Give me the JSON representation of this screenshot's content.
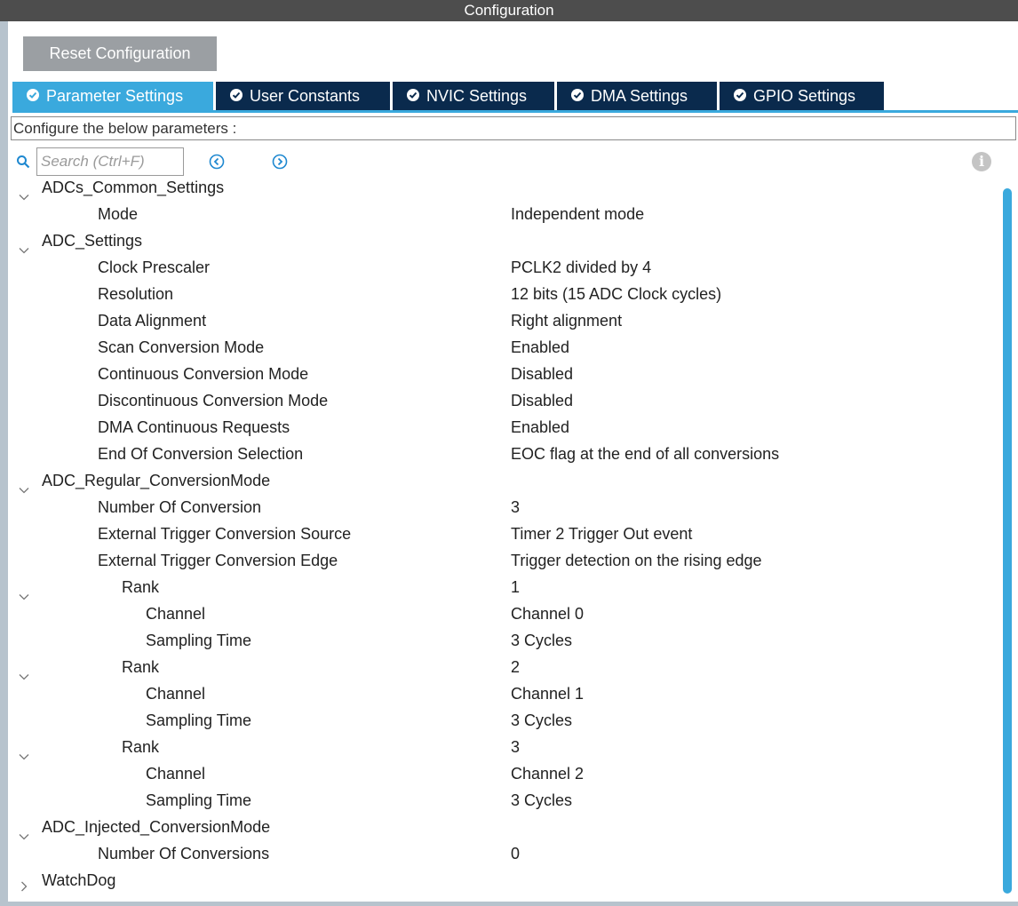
{
  "window": {
    "title": "Configuration"
  },
  "toolbar": {
    "reset_label": "Reset Configuration"
  },
  "tabs": [
    {
      "label": "Parameter Settings",
      "active": true
    },
    {
      "label": "User Constants",
      "active": false
    },
    {
      "label": "NVIC Settings",
      "active": false
    },
    {
      "label": "DMA Settings",
      "active": false
    },
    {
      "label": "GPIO Settings",
      "active": false
    }
  ],
  "description": "Configure the below parameters :",
  "search": {
    "placeholder": "Search (Ctrl+F)"
  },
  "icons": {
    "search": "search-icon",
    "prev": "chevron-left-circle-icon",
    "next": "chevron-right-circle-icon",
    "info": "info-icon",
    "expanded": "chevron-down-icon",
    "collapsed": "chevron-right-icon"
  },
  "colors": {
    "accent": "#3aa9dd",
    "tab_bg": "#0a2a4d",
    "titlebar": "#4d4d4d",
    "button": "#9b9fa3"
  },
  "tree": [
    {
      "label": "ADCs_Common_Settings",
      "value": "",
      "level": 0,
      "toggle": "expanded"
    },
    {
      "label": "Mode",
      "value": "Independent mode",
      "level": 1,
      "toggle": ""
    },
    {
      "label": "ADC_Settings",
      "value": "",
      "level": 0,
      "toggle": "expanded"
    },
    {
      "label": "Clock Prescaler",
      "value": "PCLK2 divided by 4",
      "level": 1,
      "toggle": ""
    },
    {
      "label": "Resolution",
      "value": "12 bits (15 ADC Clock cycles)",
      "level": 1,
      "toggle": ""
    },
    {
      "label": "Data Alignment",
      "value": "Right alignment",
      "level": 1,
      "toggle": ""
    },
    {
      "label": "Scan Conversion Mode",
      "value": "Enabled",
      "level": 1,
      "toggle": ""
    },
    {
      "label": "Continuous Conversion Mode",
      "value": "Disabled",
      "level": 1,
      "toggle": ""
    },
    {
      "label": "Discontinuous Conversion Mode",
      "value": "Disabled",
      "level": 1,
      "toggle": ""
    },
    {
      "label": "DMA Continuous Requests",
      "value": "Enabled",
      "level": 1,
      "toggle": ""
    },
    {
      "label": "End Of Conversion Selection",
      "value": "EOC flag at the end of all conversions",
      "level": 1,
      "toggle": ""
    },
    {
      "label": "ADC_Regular_ConversionMode",
      "value": "",
      "level": 0,
      "toggle": "expanded"
    },
    {
      "label": "Number Of Conversion",
      "value": "3",
      "level": 1,
      "toggle": ""
    },
    {
      "label": "External Trigger Conversion Source",
      "value": "Timer 2 Trigger Out event",
      "level": 1,
      "toggle": ""
    },
    {
      "label": "External Trigger Conversion Edge",
      "value": "Trigger detection on the rising edge",
      "level": 1,
      "toggle": ""
    },
    {
      "label": "Rank",
      "value": "1",
      "level": 2,
      "toggle": "expanded"
    },
    {
      "label": "Channel",
      "value": "Channel 0",
      "level": 3,
      "toggle": ""
    },
    {
      "label": "Sampling Time",
      "value": "3 Cycles",
      "level": 3,
      "toggle": ""
    },
    {
      "label": "Rank",
      "value": "2",
      "level": 2,
      "toggle": "expanded"
    },
    {
      "label": "Channel",
      "value": "Channel 1",
      "level": 3,
      "toggle": ""
    },
    {
      "label": "Sampling Time",
      "value": "3 Cycles",
      "level": 3,
      "toggle": ""
    },
    {
      "label": "Rank",
      "value": "3",
      "level": 2,
      "toggle": "expanded"
    },
    {
      "label": "Channel",
      "value": "Channel 2",
      "level": 3,
      "toggle": ""
    },
    {
      "label": "Sampling Time",
      "value": "3 Cycles",
      "level": 3,
      "toggle": ""
    },
    {
      "label": "ADC_Injected_ConversionMode",
      "value": "",
      "level": 0,
      "toggle": "expanded"
    },
    {
      "label": "Number Of Conversions",
      "value": "0",
      "level": 1,
      "toggle": ""
    },
    {
      "label": "WatchDog",
      "value": "",
      "level": 0,
      "toggle": "collapsed"
    }
  ]
}
